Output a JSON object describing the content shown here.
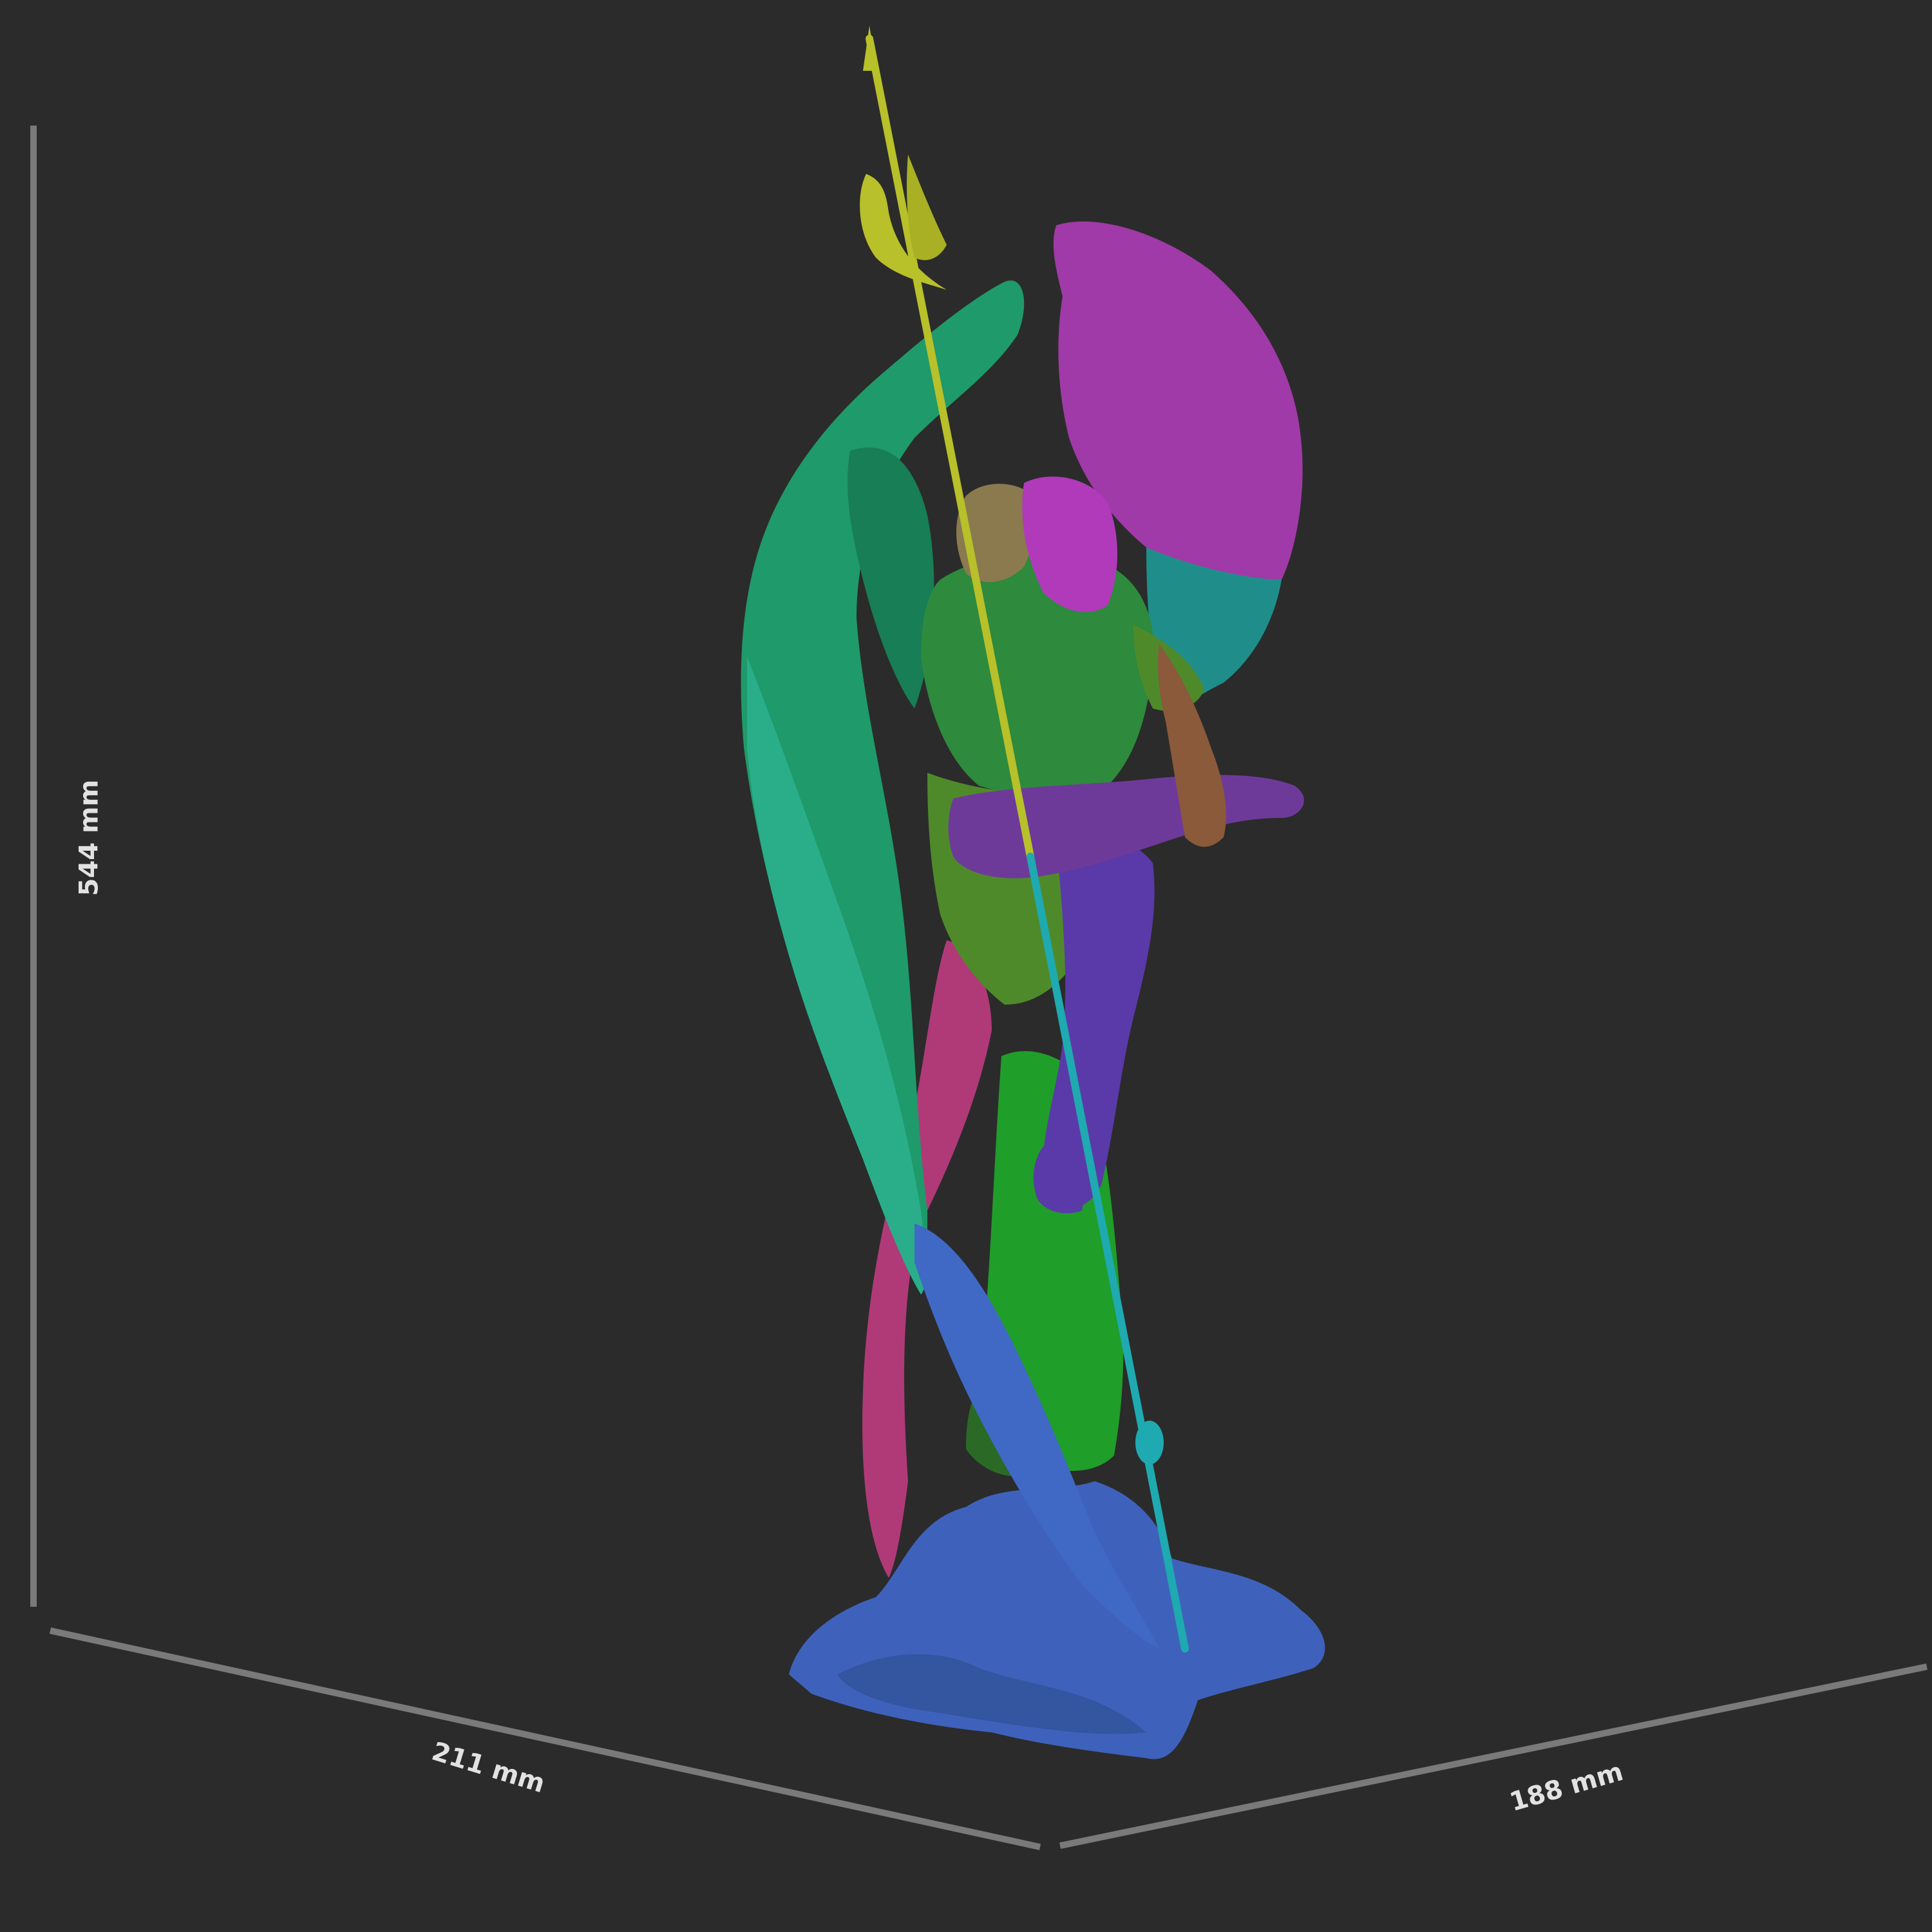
{
  "dimensions": {
    "height_label": "544 mm",
    "width_label": "211 mm",
    "depth_label": "188 mm"
  },
  "colors": {
    "background": "#2b2b2b",
    "dimension_line": "#7a7a7a",
    "label_text": "#e2e2e2",
    "left_wing": "#1f9a6a",
    "left_wing_tip": "#3f69c4",
    "right_wing": "#a03aa8",
    "right_wing_lower": "#1f8e8a",
    "body": "#2e8a3c",
    "drape": "#4f8a2a",
    "legs": "#5a3aa8",
    "crossed_leg": "#6e3a9a",
    "hair_left": "#8a7a4e",
    "hair_right": "#b03aba",
    "spear_tip": "#b8c02a",
    "spear_lower": "#1eaab0",
    "rock_pillar": "#1f9e2a",
    "base": "#3e62bc",
    "feather_pink": "#b03a78"
  }
}
